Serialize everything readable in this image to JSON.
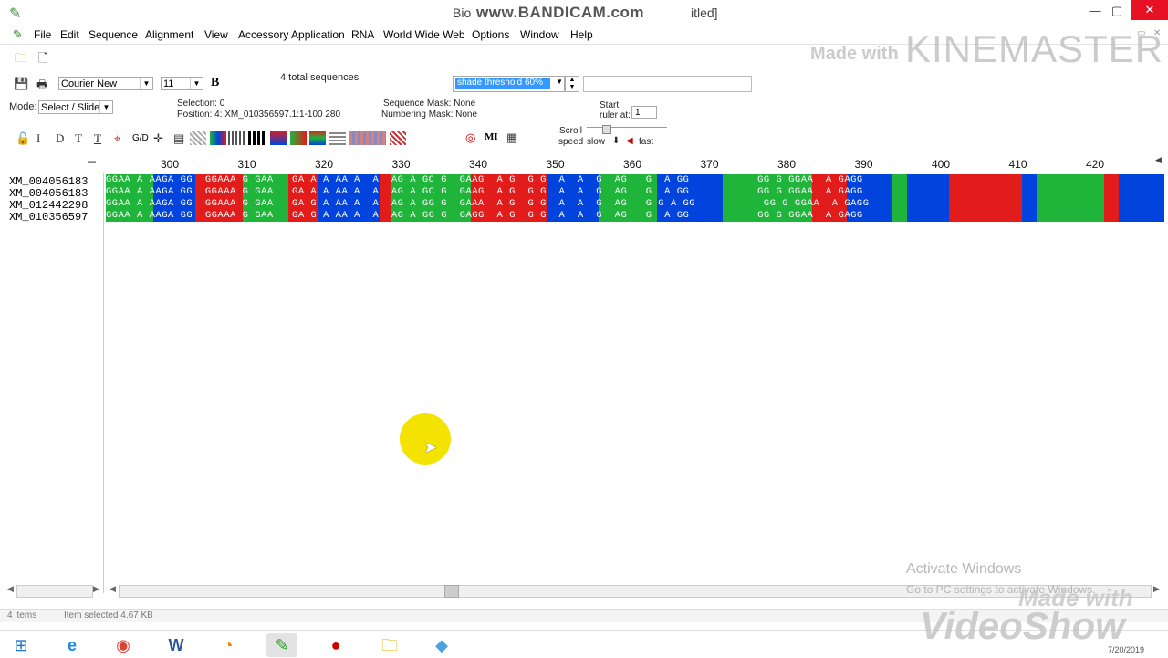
{
  "window": {
    "title": "Bio",
    "title_suffix": "itled]",
    "recorder_watermark": "www.BANDICAM.com"
  },
  "menu": [
    "File",
    "Edit",
    "Sequence",
    "Alignment",
    "View",
    "Accessory Application",
    "RNA",
    "World Wide Web",
    "Options",
    "Window",
    "Help"
  ],
  "toolbar": {
    "font_name": "Courier New",
    "font_size": "11",
    "bold_label": "B",
    "total_sequences": "4 total sequences",
    "shade_threshold": "shade threshold 60%",
    "mode_label": "Mode:",
    "mode_value": "Select / Slide",
    "selection_text": "Selection: 0",
    "position_text": "Position:  4: XM_010356597.1:1-100 280",
    "sequence_mask": "Sequence Mask: None",
    "numbering_mask": "Numbering Mask: None",
    "start_label": "Start",
    "ruler_at_label": "ruler at:",
    "ruler_at_value": "1",
    "scroll_label": "Scroll",
    "speed_label": "speed",
    "slow_label": "slow",
    "fast_label": "fast",
    "letters": [
      "I",
      "D",
      "T",
      "T"
    ],
    "gd_label": "G/D",
    "mi_label": "MI"
  },
  "ruler_ticks": [
    "300",
    "310",
    "320",
    "330",
    "340",
    "350",
    "360",
    "370",
    "380",
    "390",
    "400",
    "410",
    "420"
  ],
  "sequences": [
    {
      "name": "XM_004056183",
      "residues": "GGAA A AAGA GG  GGAAA G GAA   GA A A AA A  A  AG A GC G  GAAG  A G  G G  A  A  G  AG   G  A GG           GG G GGAA  A GAGG"
    },
    {
      "name": "XM_004056183",
      "residues": "GGAA A AAGA GG  GGAAA G GAA   GA A A AA A  A  AG A GC G  GAAG  A G  G G  A  A  G  AG   G  A GG           GG G GGAA  A GAGG"
    },
    {
      "name": "XM_012442298",
      "residues": "GGAA A AAGA GG  GGAAA G GAA   GA G A AA A  A  AG A GG G  GAAA  A G  G G  A  A  G  AG   G G A GG           GG G GGAA  A GAGG"
    },
    {
      "name": "XM_010356597",
      "residues": "GGAA A AAGA GG  GGAAA G GAA   GA G A AA A  A  AG A GG G  GAGG  A G  G G  A  A  G  AG   G  A GG           GG G GGAA  A GAGG"
    }
  ],
  "colors": {
    "A": "#1fb43a",
    "G": "#0044dd",
    "C": "#e21b1b",
    "T": "#e21b1b"
  },
  "status": {
    "left_text": "4 items",
    "mid_text": "Item selected  4.67 KB"
  },
  "watermarks": {
    "kinemaster": "KINEMASTER",
    "made_with": "Made with",
    "activate_title": "Activate Windows",
    "activate_sub": "Go to PC settings to activate Windows.",
    "videoshow": "VideoShow",
    "made_with_2": "Made with"
  },
  "clock": {
    "date": "7/20/2019"
  },
  "taskbar_icons": [
    "windows-start-icon",
    "internet-explorer-icon",
    "chrome-icon",
    "word-icon",
    "firefox-icon",
    "bioedit-icon",
    "bandicam-icon",
    "file-explorer-icon",
    "notepad-icon"
  ]
}
